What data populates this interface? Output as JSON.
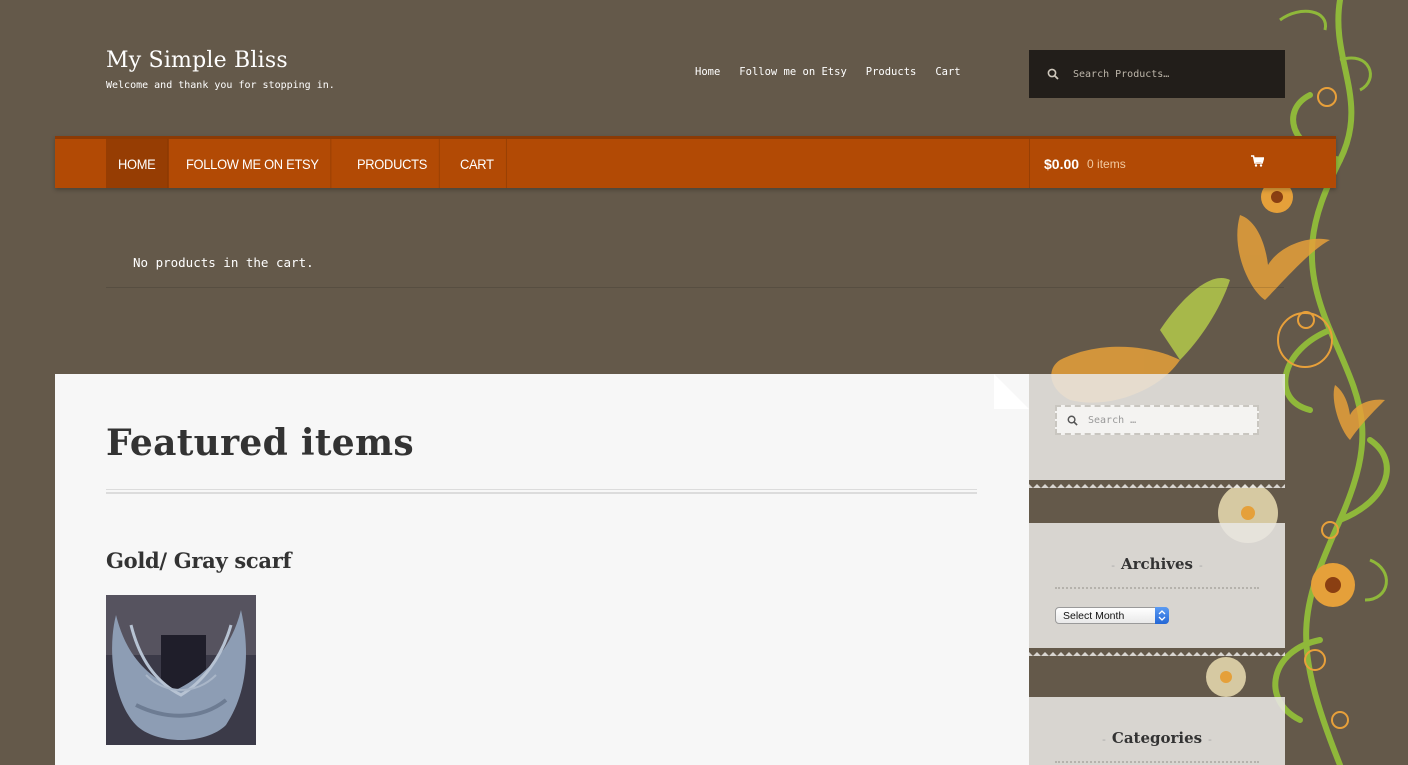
{
  "site": {
    "title": "My Simple Bliss",
    "tagline": "Welcome and thank you for stopping in."
  },
  "top_nav": [
    "Home",
    "Follow me on Etsy",
    "Products",
    "Cart"
  ],
  "header_search": {
    "placeholder": "Search Products…"
  },
  "primary_nav": {
    "items": [
      "HOME",
      "FOLLOW ME ON ETSY",
      "PRODUCTS",
      "CART"
    ],
    "active_index": 0
  },
  "cart": {
    "amount": "$0.00",
    "items": "0 items"
  },
  "cart_message": "No products in the cart.",
  "featured": {
    "title": "Featured items",
    "product_title": "Gold/ Gray scarf",
    "product_image_icon": "scarf-photo"
  },
  "sidebar": {
    "search_placeholder": "Search …",
    "archives_title": "Archives",
    "archives_select": "Select Month",
    "categories_title": "Categories"
  },
  "colors": {
    "background": "#64594a",
    "primary_bar": "#b24a05",
    "active_nav": "#963d03",
    "card": "#f7f7f7"
  }
}
